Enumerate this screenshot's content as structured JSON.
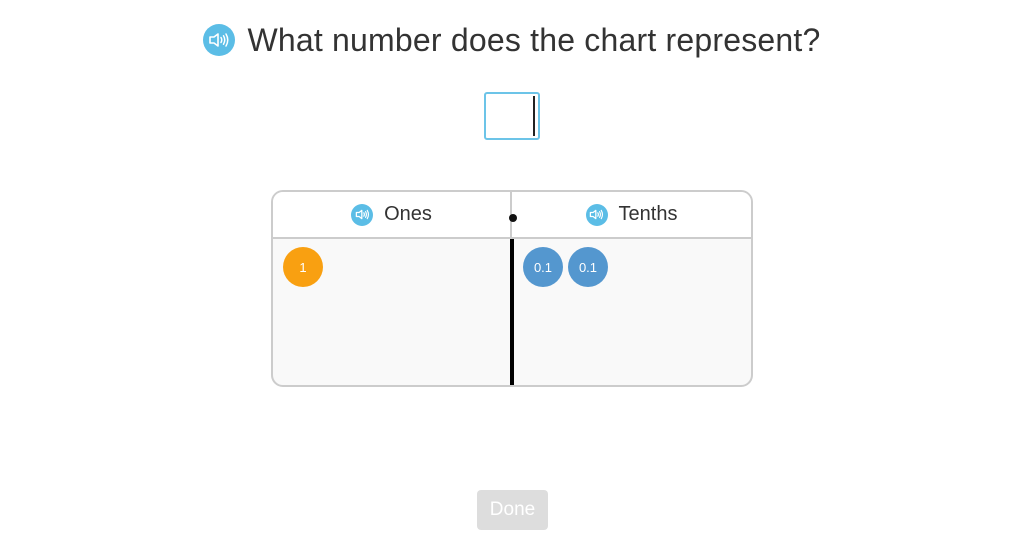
{
  "question": {
    "text": "What number does the chart represent?"
  },
  "answer": {
    "value": ""
  },
  "chart": {
    "columns": [
      {
        "label": "Ones"
      },
      {
        "label": "Tenths"
      }
    ],
    "ones_tokens": [
      "1"
    ],
    "tenths_tokens": [
      "0.1",
      "0.1"
    ]
  },
  "done_button": {
    "label": "Done"
  },
  "colors": {
    "speaker": "#5bbde6",
    "ones_token": "#f9a011",
    "tenths_token": "#5497cf",
    "done_disabled": "#dddddd"
  },
  "icons": {
    "speaker": "speaker-icon"
  }
}
